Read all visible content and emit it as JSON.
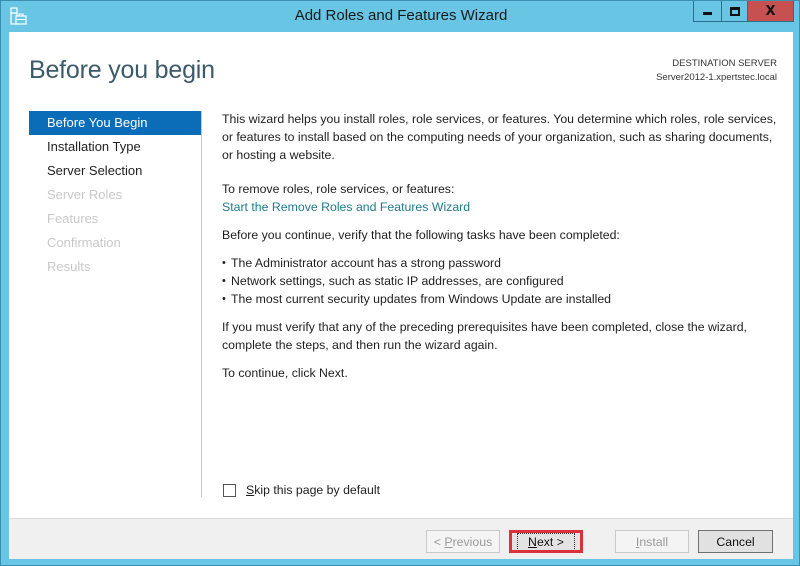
{
  "window": {
    "title": "Add Roles and Features Wizard",
    "icon": "server-manager-icon",
    "controls": {
      "minimize": "minimize-icon",
      "maximize": "maximize-icon",
      "close_glyph": "X"
    }
  },
  "header": {
    "page_title": "Before you begin",
    "destination_label": "DESTINATION SERVER",
    "destination_server": "Server2012-1.xpertstec.local"
  },
  "nav": {
    "items": [
      {
        "label": "Before You Begin",
        "state": "active"
      },
      {
        "label": "Installation Type",
        "state": "enabled"
      },
      {
        "label": "Server Selection",
        "state": "enabled"
      },
      {
        "label": "Server Roles",
        "state": "disabled"
      },
      {
        "label": "Features",
        "state": "disabled"
      },
      {
        "label": "Confirmation",
        "state": "disabled"
      },
      {
        "label": "Results",
        "state": "disabled"
      }
    ]
  },
  "content": {
    "intro": "This wizard helps you install roles, role services, or features. You determine which roles, role services, or features to install based on the computing needs of your organization, such as sharing documents, or hosting a website.",
    "remove_label": "To remove roles, role services, or features:",
    "remove_link": "Start the Remove Roles and Features Wizard",
    "verify_label": "Before you continue, verify that the following tasks have been completed:",
    "tasks": [
      "The Administrator account has a strong password",
      "Network settings, such as static IP addresses, are configured",
      "The most current security updates from Windows Update are installed"
    ],
    "prereq_note": "If you must verify that any of the preceding prerequisites have been completed, close the wizard, complete the steps, and then run the wizard again.",
    "continue_note": "To continue, click Next."
  },
  "skip": {
    "checked": false,
    "label_first": "S",
    "label_rest": "kip this page by default"
  },
  "footer": {
    "previous": {
      "prefix": "< ",
      "accel": "P",
      "rest": "revious",
      "enabled": false
    },
    "next": {
      "accel": "N",
      "rest": "ext >",
      "enabled": true,
      "highlighted": true,
      "highlight_color": "#d9323a"
    },
    "install": {
      "accel": "I",
      "rest": "nstall",
      "enabled": false
    },
    "cancel": {
      "label": "Cancel",
      "enabled": true
    }
  },
  "colors": {
    "frame": "#68c5e3",
    "nav_active": "#0b6cb8",
    "link": "#1f7a8c",
    "close_button": "#c75050"
  }
}
